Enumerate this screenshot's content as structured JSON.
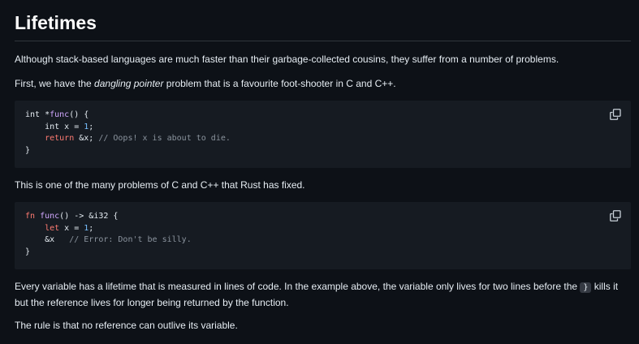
{
  "heading": "Lifetimes",
  "para1": "Although stack-based languages are much faster than their garbage-collected cousins, they suffer from a number of problems.",
  "para2": {
    "before": "First, we have the ",
    "emph": "dangling pointer",
    "after": " problem that is a favourite foot-shooter in C and C++."
  },
  "code1": {
    "l1_type": "int",
    "l1_ptr": " *",
    "l1_fn": "func",
    "l1_rest": "() {",
    "l2_indent": "    ",
    "l2_type": "int",
    "l2_mid": " x = ",
    "l2_num": "1",
    "l2_end": ";",
    "l3_indent": "    ",
    "l3_kw": "return",
    "l3_mid": " &x; ",
    "l3_comment": "// Oops! x is about to die.",
    "l4": "}"
  },
  "para3": "This is one of the many problems of C and C++ that Rust has fixed.",
  "code2": {
    "l1_kw": "fn",
    "l1_sp": " ",
    "l1_fn": "func",
    "l1_rest": "() -> &i32 {",
    "l2_indent": "    ",
    "l2_kw": "let",
    "l2_mid": " x = ",
    "l2_num": "1",
    "l2_end": ";",
    "l3_indent": "    ",
    "l3_mid": "&x   ",
    "l3_comment": "// Error: Don't be silly.",
    "l4": "}"
  },
  "para4": {
    "before": "Every variable has a lifetime that is measured in lines of code. In the example above, the variable only lives for two lines before the ",
    "code": "}",
    "after": " kills it but the reference lives for longer being returned by the function."
  },
  "para5": "The rule is that no reference can outlive its variable."
}
